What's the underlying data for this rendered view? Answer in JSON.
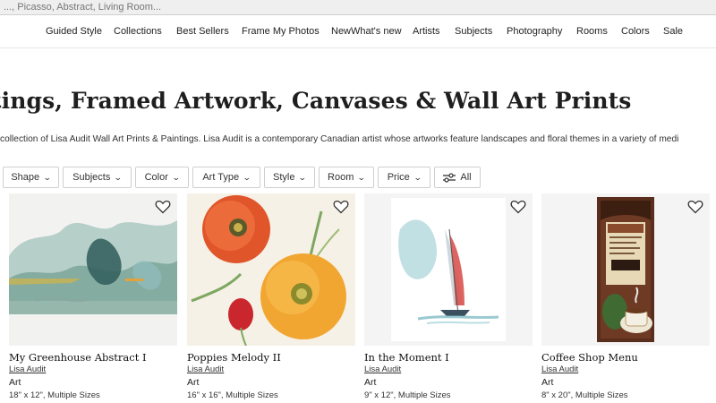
{
  "search": {
    "placeholder": "..., Picasso, Abstract, Living Room..."
  },
  "nav": {
    "items": [
      "Guided Style",
      "Collections",
      "Best Sellers",
      "Frame My Photos",
      "NewWhat's new",
      "Artists",
      "Subjects",
      "Photography",
      "Rooms",
      "Colors",
      "Sale"
    ]
  },
  "page": {
    "title": "tings, Framed Artwork, Canvases & Wall Art Prints",
    "description": "collection of Lisa Audit Wall Art Prints & Paintings. Lisa Audit is a contemporary Canadian artist whose artworks feature landscapes and floral themes in a variety of medi"
  },
  "filters": [
    {
      "label": "Shape",
      "icon": "chevron-down-icon"
    },
    {
      "label": "Subjects",
      "icon": "chevron-down-icon"
    },
    {
      "label": "Color",
      "icon": "chevron-down-icon"
    },
    {
      "label": "Art Type",
      "icon": "chevron-down-icon"
    },
    {
      "label": "Style",
      "icon": "chevron-down-icon"
    },
    {
      "label": "Room",
      "icon": "chevron-down-icon"
    },
    {
      "label": "Price",
      "icon": "chevron-down-icon"
    },
    {
      "label": "All",
      "icon": "sliders-icon"
    }
  ],
  "products": [
    {
      "title": "My Greenhouse Abstract I",
      "artist": "Lisa Audit",
      "type": "Art",
      "size": "18\" x 12\", Multiple Sizes"
    },
    {
      "title": "Poppies Melody II",
      "artist": "Lisa Audit",
      "type": "Art",
      "size": "16\" x 16\", Multiple Sizes"
    },
    {
      "title": "In the Moment I",
      "artist": "Lisa Audit",
      "type": "Art",
      "size": "9\" x 12\", Multiple Sizes"
    },
    {
      "title": "Coffee Shop Menu",
      "artist": "Lisa Audit",
      "type": "Art",
      "size": "8\" x 20\", Multiple Sizes"
    }
  ],
  "colors": {
    "border": "#cfcfcf",
    "text": "#222222"
  }
}
